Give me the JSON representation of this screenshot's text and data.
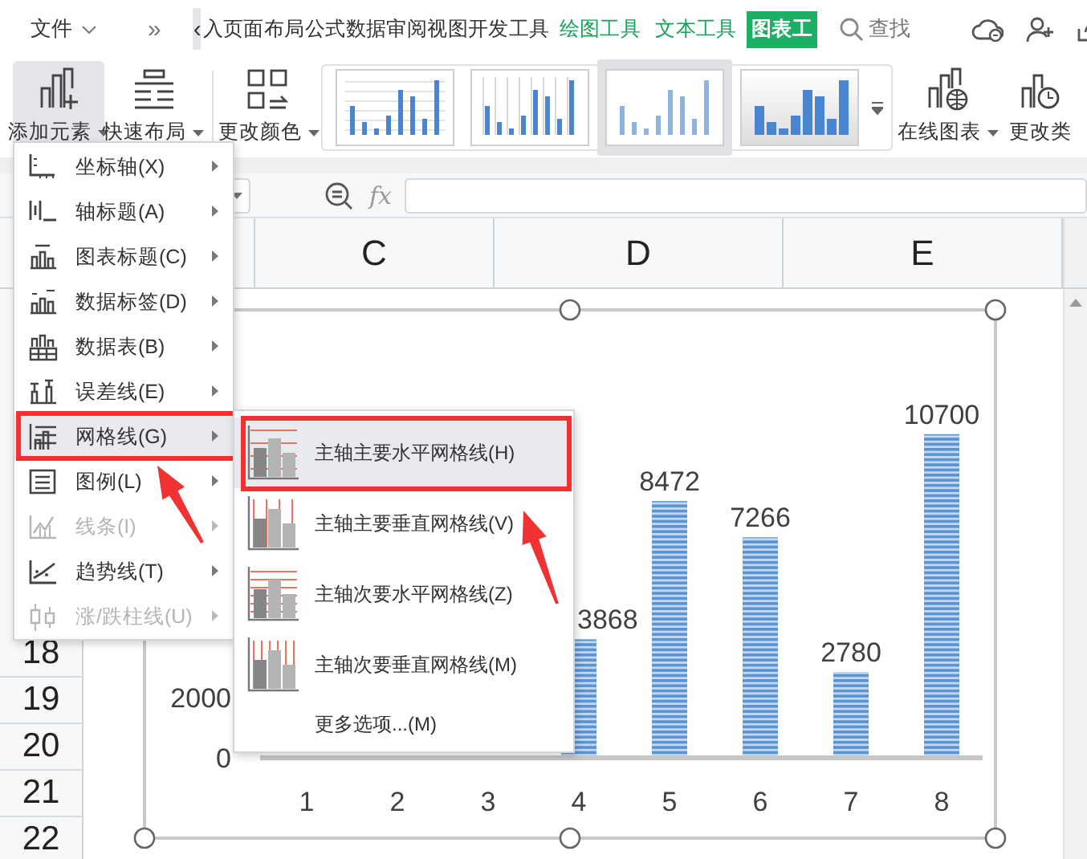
{
  "tab_bar": {
    "file_menu": "文件",
    "overflow": "»",
    "scroll_back": "‹",
    "search": "查找",
    "tabs": [
      {
        "label": "入",
        "kind": "ribbon",
        "selected": false
      },
      {
        "label": "页面布局",
        "kind": "ribbon",
        "selected": false
      },
      {
        "label": "公式",
        "kind": "ribbon",
        "selected": false
      },
      {
        "label": "数据",
        "kind": "ribbon",
        "selected": false
      },
      {
        "label": "审阅",
        "kind": "ribbon",
        "selected": false
      },
      {
        "label": "视图",
        "kind": "ribbon",
        "selected": false
      },
      {
        "label": "开发工具",
        "kind": "ribbon",
        "selected": false
      },
      {
        "label": "绘图工具",
        "kind": "tool",
        "selected": false
      },
      {
        "label": "文本工具",
        "kind": "tool",
        "selected": false
      },
      {
        "label": "图表工",
        "kind": "tool",
        "selected": true
      }
    ]
  },
  "ribbon": {
    "buttons": [
      {
        "label": "添加元素",
        "selected": true
      },
      {
        "label": "快速布局",
        "selected": false
      },
      {
        "label": "更改颜色",
        "selected": false
      }
    ],
    "styles": [
      {
        "kind": "lines",
        "selected": false
      },
      {
        "kind": "columns",
        "selected": false
      },
      {
        "kind": "striped",
        "selected": true
      },
      {
        "kind": "shaded",
        "selected": false
      }
    ],
    "more_buttons": [
      {
        "label": "在线图表",
        "dropdown": true
      },
      {
        "label": "更改类",
        "dropdown": false
      }
    ]
  },
  "formula_bar": {
    "fx": "fx"
  },
  "sheet": {
    "columns": [
      "C",
      "D",
      "E"
    ],
    "rows": [
      "18",
      "19",
      "20",
      "21",
      "22"
    ]
  },
  "chart": {
    "chart_data": {
      "type": "bar",
      "categories": [
        "1",
        "2",
        "3",
        "4",
        "5",
        "6",
        "7",
        "8"
      ],
      "values": [
        null,
        null,
        null,
        3868,
        8472,
        7266,
        2780,
        10700
      ],
      "value_labels": [
        null,
        null,
        null,
        "3868",
        "8472",
        "7266",
        "2780",
        "10700"
      ],
      "ylim": [
        0,
        11000
      ],
      "yticks": [
        {
          "value": 0,
          "label": "0"
        },
        {
          "value": 2000,
          "label": "2000"
        }
      ]
    }
  },
  "menu": {
    "items": [
      {
        "label": "坐标轴(X)",
        "selected": false,
        "disabled": false,
        "callout": false
      },
      {
        "label": "轴标题(A)",
        "selected": false,
        "disabled": false,
        "callout": false
      },
      {
        "label": "图表标题(C)",
        "selected": false,
        "disabled": false,
        "callout": false
      },
      {
        "label": "数据标签(D)",
        "selected": false,
        "disabled": false,
        "callout": false
      },
      {
        "label": "数据表(B)",
        "selected": false,
        "disabled": false,
        "callout": false
      },
      {
        "label": "误差线(E)",
        "selected": false,
        "disabled": false,
        "callout": false
      },
      {
        "label": "网格线(G)",
        "selected": true,
        "disabled": false,
        "callout": true
      },
      {
        "label": "图例(L)",
        "selected": false,
        "disabled": false,
        "callout": false
      },
      {
        "label": "线条(I)",
        "selected": false,
        "disabled": true,
        "callout": false
      },
      {
        "label": "趋势线(T)",
        "selected": false,
        "disabled": false,
        "callout": false
      },
      {
        "label": "涨/跌柱线(U)",
        "selected": false,
        "disabled": true,
        "callout": false
      }
    ]
  },
  "submenu": {
    "items": [
      {
        "label": "主轴主要水平网格线(H)",
        "kind": "h-major",
        "selected": true,
        "callout": true
      },
      {
        "label": "主轴主要垂直网格线(V)",
        "kind": "v-major",
        "selected": false,
        "callout": false
      },
      {
        "label": "主轴次要水平网格线(Z)",
        "kind": "h-minor",
        "selected": false,
        "callout": false
      },
      {
        "label": "主轴次要垂直网格线(M)",
        "kind": "v-minor",
        "selected": false,
        "callout": false
      },
      {
        "label": "更多选项...(M)",
        "kind": "plain",
        "selected": false,
        "callout": false
      }
    ]
  }
}
